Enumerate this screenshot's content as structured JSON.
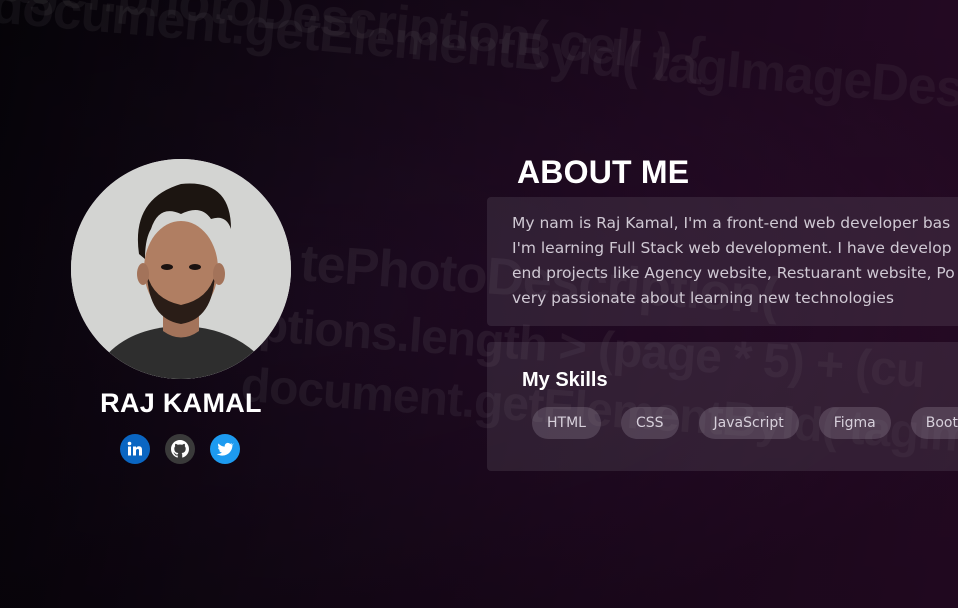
{
  "profile": {
    "name": "RAJ KAMAL",
    "socials": [
      {
        "icon": "linkedin-icon",
        "color": "#0a66c2"
      },
      {
        "icon": "github-icon",
        "color": "#3a3a3a"
      },
      {
        "icon": "twitter-icon",
        "color": "#1d9bf0"
      }
    ]
  },
  "about": {
    "title": "ABOUT ME",
    "lines": [
      "My nam is Raj Kamal, I'm a front-end web developer bas",
      "I'm learning Full Stack web development. I have develop",
      "end projects like Agency website, Restuarant website, Po",
      "very passionate about learning new technologies"
    ]
  },
  "skills": {
    "title": "My Skills",
    "items": [
      "HTML",
      "CSS",
      "JavaScript",
      "Figma",
      "Boot"
    ]
  },
  "background_code": [
    "document.getElementById( tagImageDesc )",
    "ager.photoDescription( cell ) {",
    "tePhotoDescription(",
    "options.length > (page * 5) + (cu",
    "document.getElementById( tagImageDesc"
  ],
  "colors": {
    "background_left": "#07040b",
    "background_right": "#3a0f38",
    "card_bg": "rgba(120,110,125,0.22)",
    "text_muted": "#cfc8d3"
  }
}
